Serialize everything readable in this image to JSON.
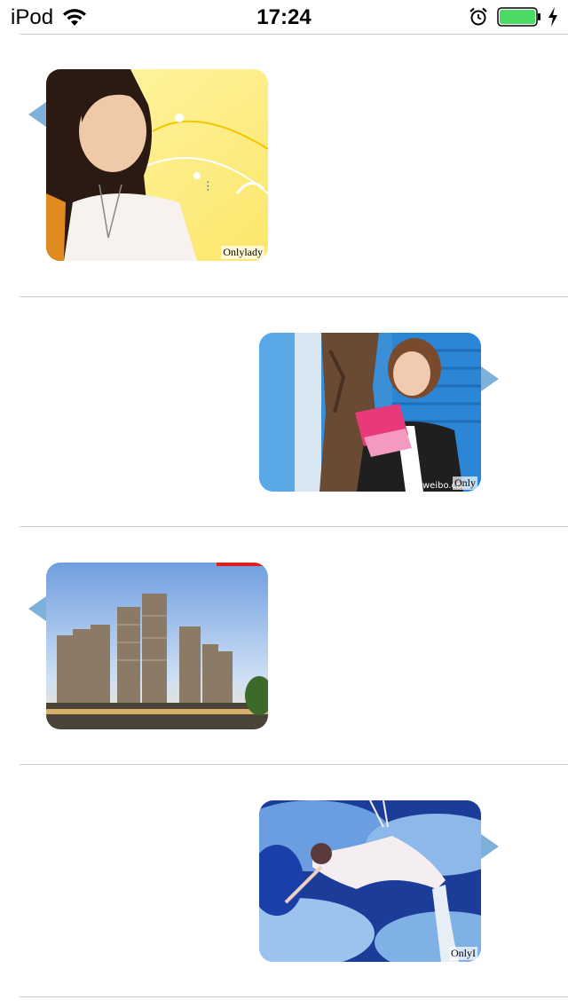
{
  "status_bar": {
    "device": "iPod",
    "time": "17:24"
  },
  "messages": [
    {
      "side": "left",
      "image": "woman-yellow-floral-photo",
      "watermark": "Onlylady"
    },
    {
      "side": "right",
      "image": "girl-reading-card-photo",
      "watermark": "Only"
    },
    {
      "side": "left",
      "image": "high-rise-buildings-photo",
      "watermark": ""
    },
    {
      "side": "right",
      "image": "woman-swing-clouds-photo",
      "watermark": "OnlyI"
    }
  ],
  "colors": {
    "divider": "#cccccc",
    "bubble_tail": "#7eb1d9",
    "battery": "#4cd964"
  }
}
